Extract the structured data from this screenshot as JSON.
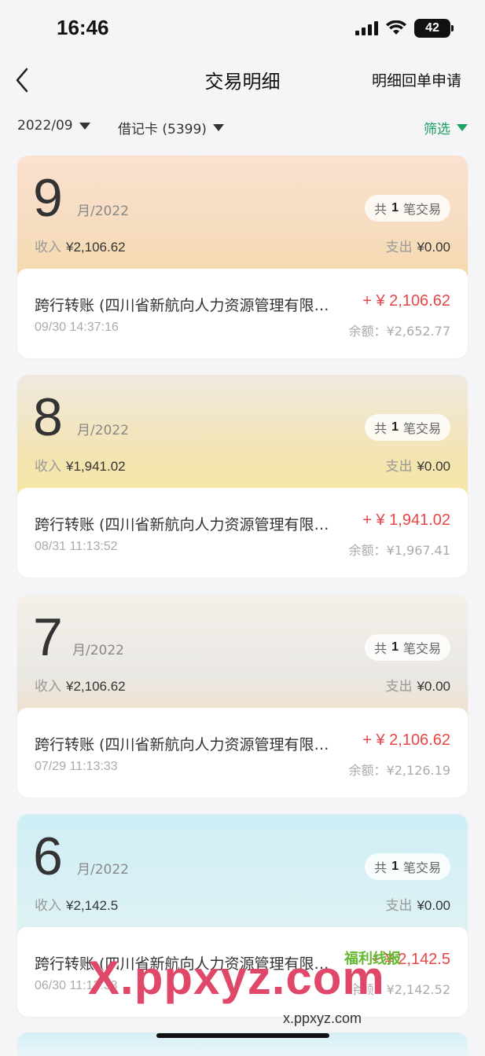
{
  "status_bar": {
    "time": "16:46",
    "battery": "42"
  },
  "nav": {
    "title": "交易明细",
    "right_action": "明细回单申请"
  },
  "filters": {
    "month": "2022/09",
    "card": "借记卡 (5399)",
    "screen": "筛选"
  },
  "labels": {
    "year_suffix": "月/2022",
    "count_prefix": "共",
    "count_suffix": "笔交易",
    "income": "收入",
    "expense": "支出",
    "balance_prefix": "余额："
  },
  "months": [
    {
      "month": "9",
      "count": "1",
      "income": "¥2,106.62",
      "expense": "¥0.00",
      "txn": {
        "title": "跨行转账 (四川省新航向人力资源管理有限公司)",
        "amount": "+ ¥ 2,106.62",
        "time": "09/30  14:37:16",
        "balance": "¥2,652.77"
      }
    },
    {
      "month": "8",
      "count": "1",
      "income": "¥1,941.02",
      "expense": "¥0.00",
      "txn": {
        "title": "跨行转账 (四川省新航向人力资源管理有限公司)",
        "amount": "+ ¥ 1,941.02",
        "time": "08/31  11:13:52",
        "balance": "¥1,967.41"
      }
    },
    {
      "month": "7",
      "count": "1",
      "income": "¥2,106.62",
      "expense": "¥0.00",
      "txn": {
        "title": "跨行转账 (四川省新航向人力资源管理有限公司)",
        "amount": "+ ¥ 2,106.62",
        "time": "07/29  11:13:33",
        "balance": "¥2,126.19"
      }
    },
    {
      "month": "6",
      "count": "1",
      "income": "¥2,142.5",
      "expense": "¥0.00",
      "txn": {
        "title": "跨行转账 (四川省新航向人力资源管理有限公司)",
        "amount": "+ ¥ 2,142.5",
        "time": "06/30  11:13:33",
        "balance": "¥2,142.52"
      }
    }
  ],
  "watermark": {
    "main": "X.ppxyz.com",
    "sub": "x.ppxyz.com",
    "logo": "福利线报"
  }
}
